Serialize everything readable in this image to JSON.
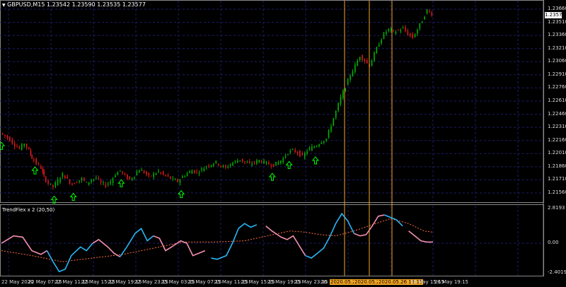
{
  "symbol_line": {
    "arrow": "▼",
    "text": "GBPUSD,M15  1.23542  1.23590  1.23535  1.23577"
  },
  "indicator_label": "TrendFlex x 2 (20,50)",
  "current_price": "1.23577",
  "price_axis": [
    "1.23660",
    "1.23510",
    "1.23360",
    "1.23210",
    "1.23060",
    "1.22910",
    "1.22760",
    "1.22610",
    "1.22460",
    "1.22310",
    "1.22160",
    "1.22010",
    "1.21860",
    "1.21710",
    "1.21560"
  ],
  "indicator_axis": [
    "2.8193",
    "0.00",
    "-2.4019"
  ],
  "time_axis": [
    "22 May 2020",
    "22 May 07:15",
    "22 May 11:15",
    "22 May 15:15",
    "22 May 19:15",
    "22 May 23:15",
    "25 May 03:15",
    "25 May 07:15",
    "25 May 11:15",
    "25 May 15:15",
    "25 May 19:15",
    "25 May 23:15",
    "26"
  ],
  "highlighted_times": [
    "2020.05.26 06:15",
    "2020.05.26 10:00",
    "2020.05.26 13:15"
  ],
  "time_axis_tail": [
    "26 May 15:15",
    "26 May 19:15"
  ],
  "colors": {
    "background": "#000000",
    "grid": "#1c1c6b",
    "bull_candle": "#00b400",
    "bear_candle": "#e11919",
    "signal_arrow": "#00ff00",
    "vertical_marker": "#f5a623",
    "indicator_up": "#29b6f6",
    "indicator_down": "#f48fb1",
    "indicator_slow": "#ff6e40"
  },
  "chart_data": {
    "type": "line",
    "price_ylim": [
      1.2156,
      1.2371
    ],
    "price_path": [
      [
        0,
        1.2231
      ],
      [
        4,
        1.2228
      ],
      [
        8,
        1.2224
      ],
      [
        12,
        1.2218
      ],
      [
        16,
        1.2214
      ],
      [
        20,
        1.222
      ],
      [
        24,
        1.2212
      ],
      [
        26,
        1.2204
      ],
      [
        30,
        1.2198
      ],
      [
        34,
        1.2193
      ],
      [
        36,
        1.2183
      ],
      [
        40,
        1.2176
      ],
      [
        44,
        1.2172
      ],
      [
        48,
        1.2179
      ],
      [
        52,
        1.2186
      ],
      [
        56,
        1.218
      ],
      [
        60,
        1.2175
      ],
      [
        64,
        1.2178
      ],
      [
        68,
        1.2181
      ],
      [
        72,
        1.2176
      ],
      [
        76,
        1.218
      ],
      [
        80,
        1.2182
      ],
      [
        84,
        1.2176
      ],
      [
        88,
        1.2174
      ],
      [
        92,
        1.2178
      ],
      [
        96,
        1.2186
      ],
      [
        100,
        1.219
      ],
      [
        104,
        1.2184
      ],
      [
        108,
        1.218
      ],
      [
        112,
        1.2185
      ],
      [
        116,
        1.2191
      ],
      [
        120,
        1.2188
      ],
      [
        124,
        1.2183
      ],
      [
        128,
        1.2186
      ],
      [
        132,
        1.2189
      ],
      [
        136,
        1.2185
      ],
      [
        140,
        1.2183
      ],
      [
        144,
        1.218
      ],
      [
        148,
        1.2178
      ],
      [
        152,
        1.2183
      ],
      [
        156,
        1.2187
      ],
      [
        160,
        1.219
      ],
      [
        164,
        1.2188
      ],
      [
        168,
        1.2191
      ],
      [
        172,
        1.2195
      ],
      [
        176,
        1.2197
      ],
      [
        180,
        1.2199
      ],
      [
        184,
        1.2195
      ],
      [
        188,
        1.2193
      ],
      [
        192,
        1.2197
      ],
      [
        196,
        1.22
      ],
      [
        200,
        1.2202
      ],
      [
        204,
        1.2199
      ],
      [
        208,
        1.2197
      ],
      [
        212,
        1.2199
      ],
      [
        216,
        1.2201
      ],
      [
        220,
        1.2199
      ],
      [
        224,
        1.2197
      ],
      [
        228,
        1.2196
      ],
      [
        232,
        1.2199
      ],
      [
        236,
        1.2203
      ],
      [
        240,
        1.221
      ],
      [
        244,
        1.2212
      ],
      [
        248,
        1.221
      ],
      [
        252,
        1.2205
      ],
      [
        256,
        1.2212
      ],
      [
        260,
        1.2215
      ],
      [
        264,
        1.2218
      ],
      [
        268,
        1.2222
      ],
      [
        272,
        1.2225
      ],
      [
        276,
        1.224
      ],
      [
        280,
        1.2255
      ],
      [
        284,
        1.227
      ],
      [
        288,
        1.2282
      ],
      [
        292,
        1.2295
      ],
      [
        296,
        1.2305
      ],
      [
        300,
        1.2316
      ],
      [
        304,
        1.2311
      ],
      [
        308,
        1.2305
      ],
      [
        312,
        1.2318
      ],
      [
        316,
        1.233
      ],
      [
        320,
        1.234
      ],
      [
        324,
        1.2345
      ],
      [
        328,
        1.2342
      ],
      [
        332,
        1.2344
      ],
      [
        336,
        1.2346
      ],
      [
        340,
        1.234
      ],
      [
        344,
        1.2336
      ],
      [
        348,
        1.2345
      ],
      [
        352,
        1.2355
      ],
      [
        356,
        1.2366
      ],
      [
        360,
        1.2362
      ]
    ],
    "indicator_ylim": [
      -2.4019,
      2.8193
    ],
    "indicator_fast": [
      [
        0,
        0.0
      ],
      [
        8,
        0.6
      ],
      [
        14,
        0.5
      ],
      [
        20,
        -0.6
      ],
      [
        26,
        -0.9
      ],
      [
        30,
        -0.6
      ],
      [
        34,
        -1.5
      ],
      [
        38,
        -2.3
      ],
      [
        42,
        -2.1
      ],
      [
        46,
        -1.0
      ],
      [
        52,
        -0.3
      ],
      [
        56,
        -0.6
      ],
      [
        60,
        0.0
      ],
      [
        64,
        0.3
      ],
      [
        70,
        -0.3
      ],
      [
        74,
        -0.8
      ],
      [
        78,
        -1.1
      ],
      [
        82,
        -0.4
      ],
      [
        88,
        0.8
      ],
      [
        92,
        1.2
      ],
      [
        96,
        0.2
      ],
      [
        100,
        0.6
      ],
      [
        104,
        0.4
      ],
      [
        108,
        -0.6
      ],
      [
        112,
        -0.3
      ],
      [
        118,
        0.2
      ],
      [
        122,
        0.0
      ],
      [
        126,
        -1.0
      ],
      [
        130,
        -0.8
      ],
      [
        134,
        -0.6
      ],
      [
        138,
        -1.2
      ],
      [
        142,
        -1.3
      ],
      [
        148,
        -1.0
      ],
      [
        152,
        0.0
      ],
      [
        156,
        1.2
      ],
      [
        160,
        1.6
      ],
      [
        164,
        1.3
      ],
      [
        168,
        1.5
      ],
      [
        174,
        1.4
      ],
      [
        178,
        1.0
      ],
      [
        184,
        0.5
      ],
      [
        188,
        0.3
      ],
      [
        192,
        0.6
      ],
      [
        196,
        -0.2
      ],
      [
        200,
        -1.0
      ],
      [
        204,
        -1.2
      ],
      [
        208,
        -0.8
      ],
      [
        212,
        -0.4
      ],
      [
        216,
        0.5
      ],
      [
        220,
        1.6
      ],
      [
        224,
        2.4
      ],
      [
        228,
        1.8
      ],
      [
        232,
        0.8
      ],
      [
        236,
        0.6
      ],
      [
        240,
        0.7
      ],
      [
        244,
        1.4
      ],
      [
        248,
        2.2
      ],
      [
        252,
        2.3
      ],
      [
        256,
        2.1
      ],
      [
        260,
        1.9
      ],
      [
        264,
        1.4
      ],
      [
        268,
        1.0
      ],
      [
        272,
        0.6
      ],
      [
        276,
        0.2
      ],
      [
        280,
        0.1
      ],
      [
        284,
        0.1
      ]
    ],
    "indicator_slow": [
      [
        0,
        -0.6
      ],
      [
        20,
        -1.0
      ],
      [
        40,
        -1.5
      ],
      [
        60,
        -1.2
      ],
      [
        80,
        -0.9
      ],
      [
        100,
        -0.4
      ],
      [
        120,
        0.1
      ],
      [
        140,
        0.1
      ],
      [
        160,
        0.2
      ],
      [
        175,
        0.6
      ],
      [
        190,
        1.0
      ],
      [
        200,
        0.9
      ],
      [
        210,
        0.7
      ],
      [
        220,
        0.6
      ],
      [
        232,
        1.0
      ],
      [
        244,
        1.5
      ],
      [
        256,
        2.0
      ],
      [
        268,
        1.6
      ],
      [
        278,
        1.0
      ],
      [
        284,
        0.9
      ]
    ],
    "signal_arrows_x": [
      0,
      28,
      44,
      60,
      100,
      150,
      226,
      240,
      262
    ],
    "fast_color_split": [
      [
        0,
        30,
        "down"
      ],
      [
        30,
        60,
        "up"
      ],
      [
        60,
        78,
        "down"
      ],
      [
        78,
        100,
        "up"
      ],
      [
        100,
        135,
        "down"
      ],
      [
        135,
        170,
        "up"
      ],
      [
        170,
        200,
        "down"
      ],
      [
        200,
        232,
        "up"
      ],
      [
        232,
        252,
        "down"
      ],
      [
        252,
        266,
        "up"
      ],
      [
        266,
        284,
        "down"
      ]
    ]
  }
}
